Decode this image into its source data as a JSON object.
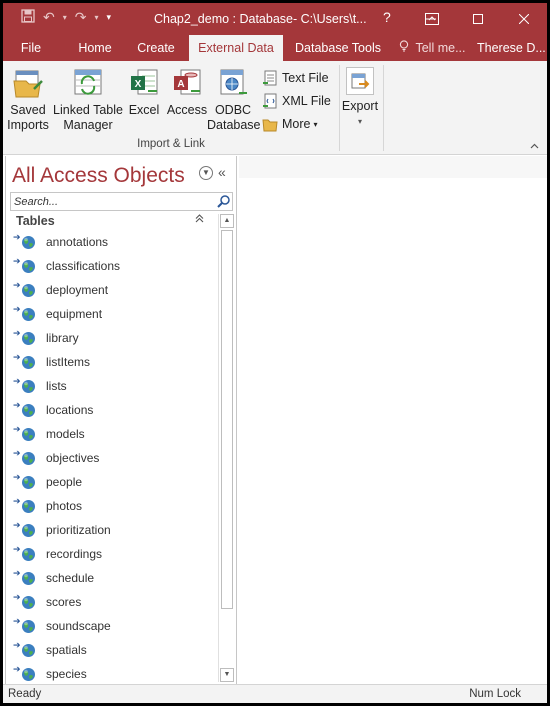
{
  "window": {
    "title": "Chap2_demo : Database- C:\\Users\\t...",
    "help": "?"
  },
  "ribbon": {
    "tabs": [
      "File",
      "Home",
      "Create",
      "External Data",
      "Database Tools"
    ],
    "active_tab": "External Data",
    "tell_me": "Tell me...",
    "user": "Therese D...",
    "buttons": {
      "saved_imports": [
        "Saved",
        "Imports"
      ],
      "linked_table_manager": [
        "Linked Table",
        "Manager"
      ],
      "excel": "Excel",
      "access": "Access",
      "odbc": [
        "ODBC",
        "Database"
      ],
      "text_file": "Text File",
      "xml_file": "XML File",
      "more": "More",
      "export": "Export"
    },
    "group_import": "Import & Link"
  },
  "nav": {
    "title": "All Access Objects",
    "search_placeholder": "Search...",
    "group": "Tables",
    "items": [
      "annotations",
      "classifications",
      "deployment",
      "equipment",
      "library",
      "listItems",
      "lists",
      "locations",
      "models",
      "objectives",
      "people",
      "photos",
      "prioritization",
      "recordings",
      "schedule",
      "scores",
      "soundscape",
      "spatials",
      "species"
    ]
  },
  "status": {
    "left": "Ready",
    "right": "Num Lock"
  },
  "colors": {
    "accent": "#a4373a",
    "ribbon_bg": "#f3f3f3"
  }
}
